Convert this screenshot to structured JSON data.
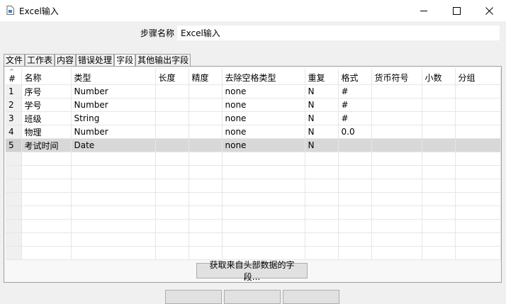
{
  "window": {
    "title": "Excel输入",
    "icon": "document-icon",
    "minimize": "—",
    "maximize": "☐",
    "close": "✕"
  },
  "step": {
    "label": "步骤名称",
    "value": "Excel输入"
  },
  "tabs": [
    {
      "label": "文件"
    },
    {
      "label": "工作表"
    },
    {
      "label": "内容"
    },
    {
      "label": "错误处理"
    },
    {
      "label": "字段"
    },
    {
      "label": "其他输出字段"
    }
  ],
  "active_tab": "字段",
  "grid": {
    "columns": [
      "#",
      "名称",
      "类型",
      "长度",
      "精度",
      "去除空格类型",
      "重复",
      "格式",
      "货币符号",
      "小数",
      "分组"
    ],
    "rows": [
      [
        "1",
        "序号",
        "Number",
        "",
        "",
        "none",
        "N",
        "#",
        "",
        "",
        ""
      ],
      [
        "2",
        "学号",
        "Number",
        "",
        "",
        "none",
        "N",
        "#",
        "",
        "",
        ""
      ],
      [
        "3",
        "班级",
        "String",
        "",
        "",
        "none",
        "N",
        "#",
        "",
        "",
        ""
      ],
      [
        "4",
        "物理",
        "Number",
        "",
        "",
        "none",
        "N",
        "0.0",
        "",
        "",
        ""
      ],
      [
        "5",
        "考试时间",
        "Date",
        "",
        "",
        "none",
        "N",
        "",
        "",
        "",
        ""
      ]
    ],
    "selected_row": 5
  },
  "get_fields_button": "获取来自头部数据的字段..."
}
